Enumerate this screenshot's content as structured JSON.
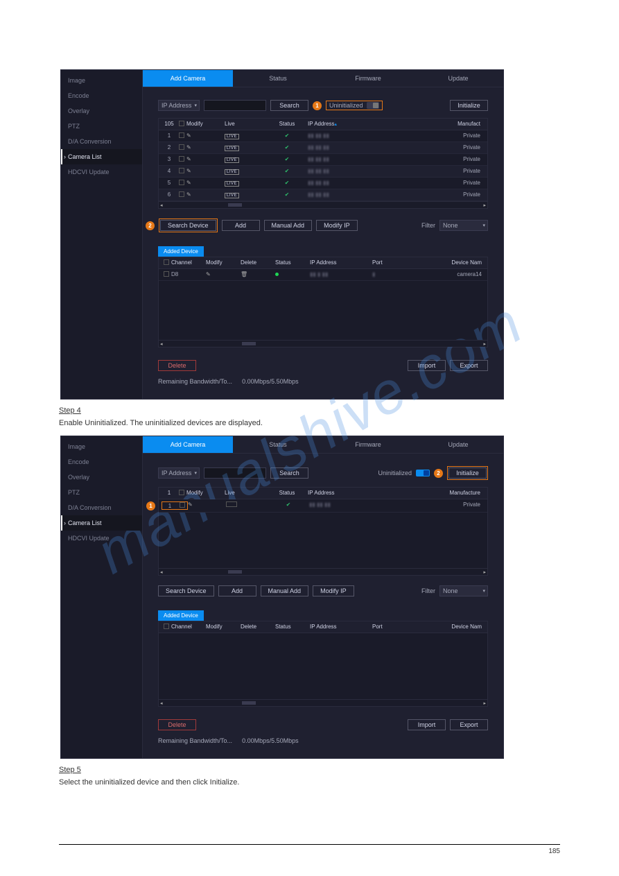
{
  "watermark": "manualshive.com",
  "sidebar": {
    "items": [
      {
        "label": "Image"
      },
      {
        "label": "Encode"
      },
      {
        "label": "Overlay"
      },
      {
        "label": "PTZ"
      },
      {
        "label": "D/A Conversion"
      },
      {
        "label": "Camera List"
      },
      {
        "label": "HDCVI Update"
      }
    ]
  },
  "tabs": [
    "Add Camera",
    "Status",
    "Firmware",
    "Update"
  ],
  "searchrow": {
    "filter_type": "IP Address",
    "search": "Search",
    "uninit": "Uninitialized",
    "init": "Initialize"
  },
  "grid1_head": {
    "count": "105",
    "modify": "Modify",
    "live": "Live",
    "status": "Status",
    "ip": "IP Address",
    "manu": "Manufact"
  },
  "grid1_rows": [
    {
      "n": "1",
      "manu": "Private"
    },
    {
      "n": "2",
      "manu": "Private"
    },
    {
      "n": "3",
      "manu": "Private"
    },
    {
      "n": "4",
      "manu": "Private"
    },
    {
      "n": "5",
      "manu": "Private"
    },
    {
      "n": "6",
      "manu": "Private"
    }
  ],
  "buttons": {
    "search_device": "Search Device",
    "add": "Add",
    "manual_add": "Manual Add",
    "modify_ip": "Modify IP",
    "filter": "Filter",
    "none": "None",
    "delete": "Delete",
    "import": "Import",
    "export": "Export"
  },
  "added_device": "Added Device",
  "grid2_head": {
    "channel": "Channel",
    "modify": "Modify",
    "delete": "Delete",
    "status": "Status",
    "ip": "IP Address",
    "port": "Port",
    "dname": "Device Nam"
  },
  "grid2_row": {
    "ch": "D8",
    "dname": "camera14"
  },
  "bandwidth_label": "Remaining Bandwidth/To...",
  "bandwidth_val": "0.00Mbps/5.50Mbps",
  "step4": "Step 4",
  "step4_text": "Enable Uninitialized.  The uninitialized devices are displayed.",
  "step5": "Step 5",
  "step5_text": "Select the uninitialized device and then click Initialize.",
  "fig2": {
    "grid1_count": "1",
    "grid1_row": {
      "n": "1",
      "manu": "Private"
    }
  },
  "footer_page": "185"
}
